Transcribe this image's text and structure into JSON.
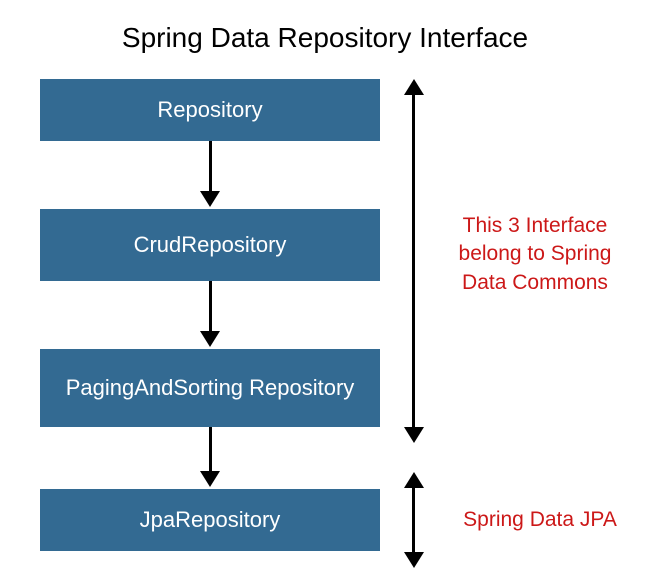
{
  "title": "Spring Data Repository Interface",
  "boxes": {
    "b1": "Repository",
    "b2": "CrudRepository",
    "b3": "PagingAndSorting Repository",
    "b4": "JpaRepository"
  },
  "annotations": {
    "a1": "This 3 Interface belong to Spring Data Commons",
    "a2": "Spring Data JPA"
  }
}
